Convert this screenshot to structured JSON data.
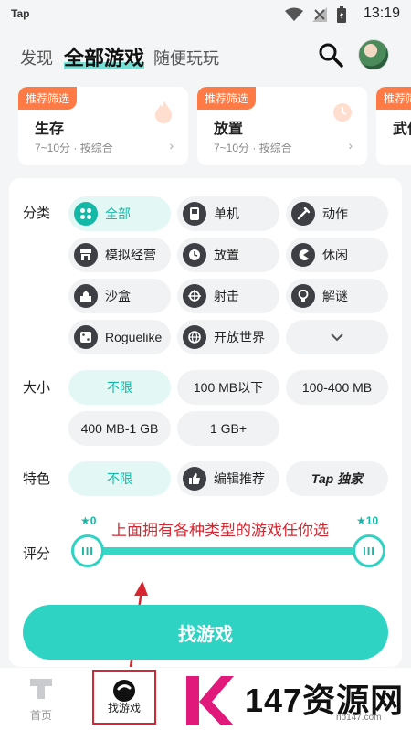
{
  "status_bar": {
    "app_name": "Tap",
    "time": "13:19"
  },
  "top_nav": {
    "tabs": [
      "发现",
      "全部游戏",
      "随便玩玩"
    ],
    "active_tab": "全部游戏"
  },
  "recommendations": [
    {
      "tag": "推荐筛选",
      "title": "生存",
      "subtitle": "7~10分 · 按综合"
    },
    {
      "tag": "推荐筛选",
      "title": "放置",
      "subtitle": "7~10分 · 按综合"
    },
    {
      "tag": "推荐筛选",
      "title": "武侠"
    }
  ],
  "filters": {
    "category_label": "分类",
    "categories": [
      "全部",
      "单机",
      "动作",
      "模拟经营",
      "放置",
      "休闲",
      "沙盒",
      "射击",
      "解谜",
      "Roguelike",
      "开放世界"
    ],
    "size_label": "大小",
    "sizes": [
      "不限",
      "100 MB以下",
      "100-400 MB",
      "400 MB-1 GB",
      "1 GB+"
    ],
    "feature_label": "特色",
    "features": [
      "不限",
      "编辑推荐",
      "Tap 独家"
    ],
    "rating_label": "评分",
    "rating_min": "0",
    "rating_max": "10",
    "rating_range": [
      0,
      10
    ]
  },
  "annotation": "上面拥有各种类型的游戏任你选",
  "find_button": "找游戏",
  "bottom_nav": {
    "tabs": [
      "首页",
      "找游戏"
    ],
    "active": "找游戏"
  },
  "watermark": {
    "text": "147资源网",
    "url": "no147.com"
  },
  "colors": {
    "accent": "#2fd3c3",
    "tag": "#ff7a45",
    "annotation": "#d7262f"
  }
}
